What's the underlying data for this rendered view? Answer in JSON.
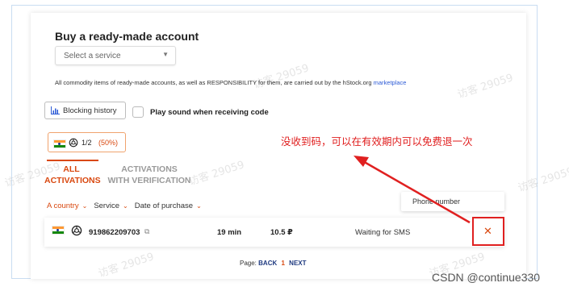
{
  "section_title": "Buy a ready-made account",
  "service_select": {
    "placeholder": "Select a service"
  },
  "notice": {
    "text": "All commodity items of ready-made accounts, as well as RESPONSIBILITY for them, are carried out by the hStock.org ",
    "link": "marketplace"
  },
  "blocking_history": {
    "label": "Blocking history",
    "icon": "bar-chart-icon"
  },
  "play_sound": {
    "label": "Play sound when receiving code",
    "checked": false
  },
  "service_pill": {
    "count": "1/2",
    "percent": "(50%)",
    "flag": "india-flag-icon",
    "logo": "openai-icon"
  },
  "annotation": "没收到码，可以在有效期内可以免费退一次",
  "tabs": [
    {
      "line1": "ALL",
      "line2": "ACTIVATIONS",
      "active": true
    },
    {
      "line1": "ACTIVATIONS",
      "line2": "WITH VERIFICATION",
      "active": false
    }
  ],
  "filters": {
    "country": "A country",
    "service": "Service",
    "date": "Date of purchase"
  },
  "phone_header": "Phone number",
  "activation": {
    "number": "919862209703",
    "copy_icon": "copy-icon",
    "time": "19 min",
    "price": "10.5 ₽",
    "status": "Waiting for SMS",
    "cancel": "✕"
  },
  "pager": {
    "label": "Page:",
    "back": "BACK",
    "current": "1",
    "next": "NEXT"
  },
  "watermark": "访客 29059",
  "footer_credit": "CSDN @continue330",
  "colors": {
    "accent": "#d9480f",
    "annotation_red": "#e02020",
    "link_blue": "#2d5bd6"
  }
}
